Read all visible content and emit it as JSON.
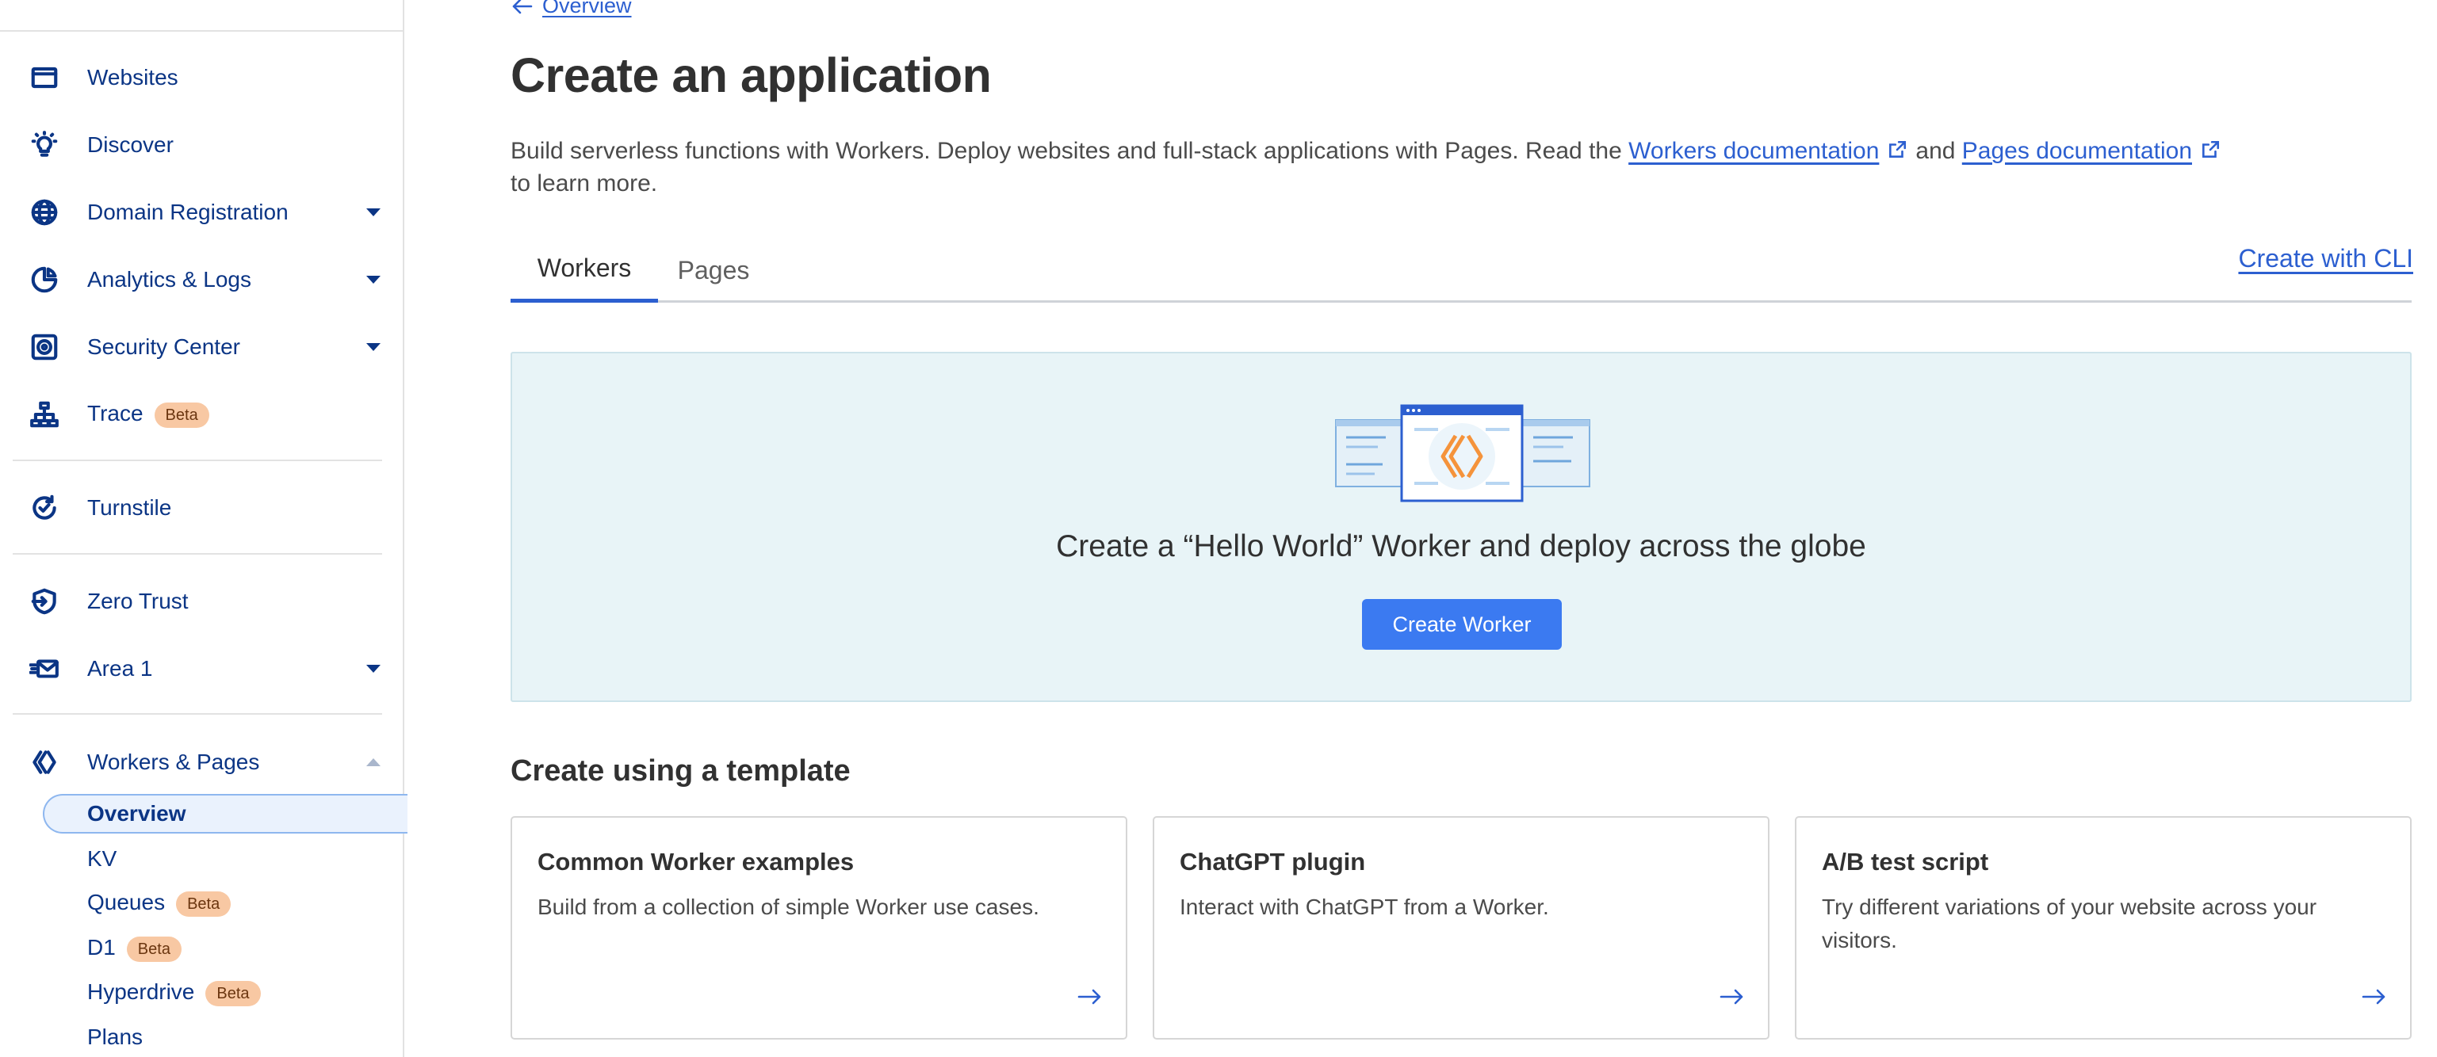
{
  "sidebar": {
    "items": [
      {
        "label": "Websites",
        "icon": "browser-window-icon"
      },
      {
        "label": "Discover",
        "icon": "lightbulb-icon"
      },
      {
        "label": "Domain Registration",
        "icon": "globe-icon"
      },
      {
        "label": "Analytics & Logs",
        "icon": "pie-chart-icon"
      },
      {
        "label": "Security Center",
        "icon": "shield-target-icon"
      },
      {
        "label": "Trace",
        "icon": "sitemap-icon",
        "badge": "Beta"
      },
      {
        "label": "Turnstile",
        "icon": "turnstile-icon"
      },
      {
        "label": "Zero Trust",
        "icon": "zero-trust-icon"
      },
      {
        "label": "Area 1",
        "icon": "email-security-icon"
      },
      {
        "label": "Workers & Pages",
        "icon": "workers-icon"
      }
    ],
    "sub_items": [
      {
        "label": "Overview"
      },
      {
        "label": "KV"
      },
      {
        "label": "Queues",
        "badge": "Beta"
      },
      {
        "label": "D1",
        "badge": "Beta"
      },
      {
        "label": "Hyperdrive",
        "badge": "Beta"
      },
      {
        "label": "Plans"
      }
    ]
  },
  "breadcrumb": {
    "back_label": "Overview"
  },
  "page": {
    "title": "Create an application",
    "description_prefix": "Build serverless functions with Workers. Deploy websites and full-stack applications with Pages. Read the",
    "workers_doc_link": "Workers documentation",
    "and_text": "and",
    "pages_doc_link": "Pages documentation",
    "description_suffix": "to learn more."
  },
  "tabs": [
    {
      "label": "Workers",
      "active": true
    },
    {
      "label": "Pages",
      "active": false
    }
  ],
  "cli_link": "Create with CLI",
  "hero": {
    "text": "Create a “Hello World” Worker and deploy across the globe",
    "button": "Create Worker"
  },
  "templates": {
    "title": "Create using a template",
    "cards": [
      {
        "title": "Common Worker examples",
        "description": "Build from a collection of simple Worker use cases."
      },
      {
        "title": "ChatGPT plugin",
        "description": "Interact with ChatGPT from a Worker."
      },
      {
        "title": "A/B test script",
        "description": "Try different variations of your website across your visitors."
      }
    ]
  },
  "colors": {
    "link": "#2c5fd0",
    "nav_text": "#0b3585",
    "primary_button": "#3b7af1",
    "hero_bg": "#e8f4f7",
    "badge_bg": "#f8c8a3"
  }
}
